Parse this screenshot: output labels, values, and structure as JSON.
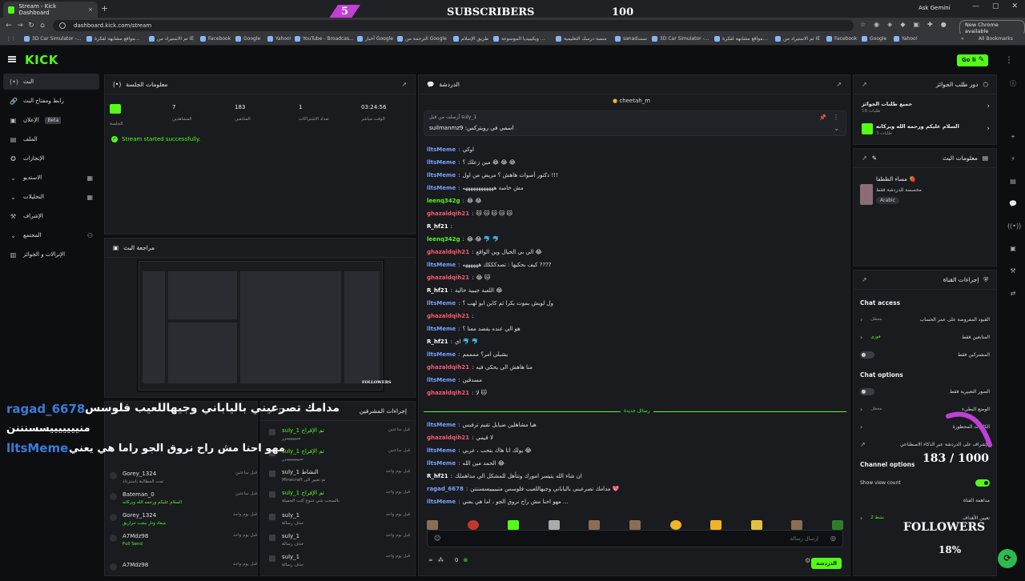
{
  "browser": {
    "tab_title": "Stream - Kick Dashboard",
    "tab_close": "×",
    "new_tab": "+",
    "url": "dashboard.kick.com/stream",
    "ask_gemini": "Ask Gemini",
    "new_chrome": "New Chrome available",
    "all_bookmarks": "All Bookmarks",
    "bookmarks": [
      "3D Car Simulator -...",
      "مواقع مشابهة لفكرة...",
      "تم الاستيراد من IE",
      "Facebook",
      "Google",
      "Yahoo!",
      "YouTube - Broadcas...",
      "أخبار Google",
      "الترجمة من Google",
      "طريق الإسلام",
      "ويكيبيديا الموسوعة ...",
      "منصة درسك التعليمية",
      "sanadنسند",
      "3D Car Simulator -...",
      "مواقع مشابهة لفكرة...",
      "تم الاستيراد من IE",
      "Facebook",
      "Google",
      "Yahoo!"
    ]
  },
  "overlay": {
    "sub_count": "5",
    "sub_label": "SUBSCRIBERS",
    "sub_goal": "100",
    "chat_user1": "ragad_6678",
    "chat_msg1": "مدامك تصرعيني بالياباني وجيهاللعيب فلوسس",
    "chat_msg2": "منيييييييسسنننن",
    "chat_user2": "lltsMeme",
    "chat_msg3": "مهو احنا مش راح نروق الجو راما هي يعني",
    "follower_count": "183 / 1000",
    "followers_label": "FOLLOWERS",
    "followers_pct": "18%"
  },
  "header": {
    "logo": "KICK",
    "go_live": "Go live"
  },
  "sidebar": {
    "items": [
      {
        "label": "البث",
        "icon": "(•)"
      },
      {
        "label": "رابط ومفتاح البث",
        "icon": "🔗"
      },
      {
        "label": "الإعلان",
        "icon": "▣",
        "badge": "Beta"
      },
      {
        "label": "الملف",
        "icon": "▤"
      },
      {
        "label": "الإنجازات",
        "icon": "✪"
      },
      {
        "label": "الاستديو",
        "icon": "⌄",
        "right": "▦"
      },
      {
        "label": "التحليلات",
        "icon": "⌄",
        "right": "▦"
      },
      {
        "label": "الإشراف",
        "icon": "⚒"
      },
      {
        "label": "المجتمع",
        "icon": "⌄",
        "right": "⚇"
      },
      {
        "label": "الإنزالات و الجوائز",
        "icon": "▥"
      }
    ]
  },
  "session": {
    "title": "معلومات الجلسة",
    "badge_label": "الجلسة",
    "stats": [
      {
        "value": "7",
        "label": "المشاهدين"
      },
      {
        "value": "183",
        "label": "المتابعين"
      },
      {
        "value": "1",
        "label": "تعداد الاشتراكات"
      },
      {
        "value": "03:24:56",
        "label": "الوقت مباشر"
      }
    ],
    "status": "Stream started successfully."
  },
  "preview": {
    "title": "مراجعة البث",
    "followers": "FOLLOWERS"
  },
  "activity": {
    "rows": [
      {
        "name": "Gorey_1324",
        "desc": "تمت المطالبة باسترداد",
        "time": "قبل ساعتين",
        "green": false
      },
      {
        "name": "Bateman_0",
        "desc": "السلام عليكم ورحمه الله وبركاته",
        "time": "قبل ساعتين",
        "green": true
      },
      {
        "name": "Gorey_1324",
        "desc": "ميعاد ونار ببجب حراريق",
        "time": "قبل يوم واحد",
        "green": true
      },
      {
        "name": "A7Mdz98",
        "desc": "Full Send",
        "time": "قبل يوم واحد",
        "green": true
      },
      {
        "name": "A7Mdz98",
        "desc": "",
        "time": "قبل يوم واحد",
        "green": false
      }
    ]
  },
  "mod_actions": {
    "title": "إجراءات المشرفين",
    "rows": [
      {
        "name": "suly_1 تم الإفراج",
        "desc": "سيييييييبرر",
        "time": "قبل ساعتين",
        "green": true
      },
      {
        "name": "suly_1 تم الإفراج",
        "desc": "سيييييييييبرر",
        "time": "قبل ساعتين",
        "green": true
      },
      {
        "name": "suly_1 النشاط",
        "desc": "Minecraft تم تغيير الى",
        "time": "قبل يوم واحد",
        "green": false
      },
      {
        "name": "suly_1 تم الإفراج",
        "desc": "بالسحب شي تتنوع كتب الجميلة",
        "time": "قبل يوم واحد",
        "green": true
      },
      {
        "name": "suly_1",
        "desc": "حذف رسالة",
        "time": "قبل يوم واحد",
        "green": false
      },
      {
        "name": "suly_1",
        "desc": "حذف رسالة",
        "time": "قبل يوم واحد",
        "green": false
      },
      {
        "name": "suly_1",
        "desc": "حذف رسالة",
        "time": "قبل يوم واحد",
        "green": false
      }
    ]
  },
  "chat": {
    "title": "الدردشة",
    "top_user": "cheetah_m",
    "pinned_by": "أرسلت من قبل suly_1",
    "pinned_msg": "suilmanmz9 :اسمي في رويتركس",
    "messages": [
      {
        "user": "lltsMeme",
        "text": "اوكي",
        "color": "blue"
      },
      {
        "user": "lltsMeme",
        "text": "مين زعلك ؟ 😂 😂 😂",
        "color": "blue"
      },
      {
        "user": "lltsMeme",
        "text": "دكتور أصوات هاهش ؟ مريض من اول !!!",
        "color": "blue"
      },
      {
        "user": "lltsMeme",
        "text": "مش خاصة ههههههههههههه",
        "color": "blue"
      },
      {
        "user": "leenq342g",
        "text": "😂 😂",
        "color": "green"
      },
      {
        "user": "ghazaldqih21",
        "text": "🐱 🐱 🐱 🐱 🐱",
        "color": "red"
      },
      {
        "user": "R_hf21",
        "text": "",
        "color": "white"
      },
      {
        "user": "leenq342g",
        "text": "😂 😂 🐬 🐬",
        "color": "green"
      },
      {
        "user": "ghazaldqih21",
        "text": "الي بي الخيال وين الواقع 😂",
        "color": "red"
      },
      {
        "user": "lltsMeme",
        "text": "كيف بحكيها : تصدكككك ههههههه ????",
        "color": "blue"
      },
      {
        "user": "ghazaldqih21",
        "text": "😂 🐱",
        "color": "red"
      },
      {
        "user": "R_hf21",
        "text": "اللعبة جيبية خالية 😂",
        "color": "white"
      },
      {
        "user": "lltsMeme",
        "text": "ول لويش بموت بكرا ثم كاين ابو لهب ؟",
        "color": "blue"
      },
      {
        "user": "ghazaldqih21",
        "text": "",
        "color": "red"
      },
      {
        "user": "lltsMeme",
        "text": "هو الي عنده يفضد معنا ؟",
        "color": "blue"
      },
      {
        "user": "R_hf21",
        "text": "اي 🐬 🐬",
        "color": "white"
      },
      {
        "user": "lltsMeme",
        "text": "يشبلي امر؟ ممممم",
        "color": "blue"
      },
      {
        "user": "ghazaldqih21",
        "text": "منا هاهش الي يحكي فيه",
        "color": "red"
      },
      {
        "user": "lltsMeme",
        "text": "مسدقين",
        "color": "blue"
      },
      {
        "user": "ghazaldqih21",
        "text": "لا 🐱",
        "color": "red"
      }
    ],
    "new_messages": "رسائل جديدة",
    "messages2": [
      {
        "user": "lltsMeme",
        "text": "هيا مشاهلين ضيايل تقيم ترفيس",
        "color": "blue"
      },
      {
        "user": "ghazaldqih21",
        "text": "لا قيمي",
        "color": "red"
      },
      {
        "user": "lltsMeme",
        "text": "يولك انا هاك بتحب ، عربي 😂",
        "color": "blue"
      },
      {
        "user": "lltsMeme",
        "text": "الحمد مين الله 😂",
        "color": "blue"
      },
      {
        "user": "R_hf21",
        "text": "ان شاء الله يتيسر امورك وتتأهل للمشكل الي مداهملك",
        "color": "white"
      },
      {
        "user": "ragad_6678",
        "text": "مدامك تصرعيني بالياباني وجيهاللعيب فلوسس منيييييسسنننن 💖",
        "color": "blue"
      },
      {
        "user": "lltsMeme",
        "text": "مهو احنا مش راح نروق الجو ، اما هي يعني ...",
        "color": "blue"
      }
    ],
    "input_placeholder": "إرسال رسالة",
    "send": "الدردشة",
    "viewer_count": "0"
  },
  "rewards": {
    "title": "دور طلب الجوائز",
    "rows": [
      {
        "title": "جميع طلبات الجوائز",
        "sub": "طلبات 18"
      },
      {
        "title": "السلام عليكم ورحمه الله وبركاته",
        "sub": "طلبات 3"
      }
    ]
  },
  "stream_info": {
    "title": "معلومات البث",
    "stream_title": "مساء الظظفا 🍓",
    "category": "مخصصة للدردشة فقط",
    "language": "Arabic"
  },
  "channel_actions": {
    "title": "إجراءات القناة",
    "chat_access": "Chat access",
    "access_rows": [
      {
        "label": "القيود المفروضة على عمر الحساب",
        "val": "معطل",
        "type": "chevron"
      },
      {
        "label": "المتابعين فقط",
        "val": "فوري",
        "type": "chevron",
        "green": true
      },
      {
        "label": "المشتركين فقط",
        "val": "",
        "type": "toggle"
      }
    ],
    "chat_options": "Chat options",
    "option_rows": [
      {
        "label": "الصور التعبيرية فقط",
        "val": "",
        "type": "toggle"
      },
      {
        "label": "الوضع البطيء",
        "val": "معطل",
        "type": "chevron"
      },
      {
        "label": "الكلمات المحظورة",
        "val": "",
        "type": "chevron"
      },
      {
        "label": "الإشراف على الدردشة عبر الذكاء الاصطناعي",
        "val": "",
        "type": "pop"
      }
    ],
    "channel_options": "Channel options",
    "show_view_count": "Show view count",
    "channel_rows": [
      {
        "label": "مداهمة القناة",
        "val": "",
        "type": "none"
      },
      {
        "label": "تعيين الأهداف",
        "val": "2 نشط",
        "type": "chevron",
        "green": true
      }
    ]
  }
}
